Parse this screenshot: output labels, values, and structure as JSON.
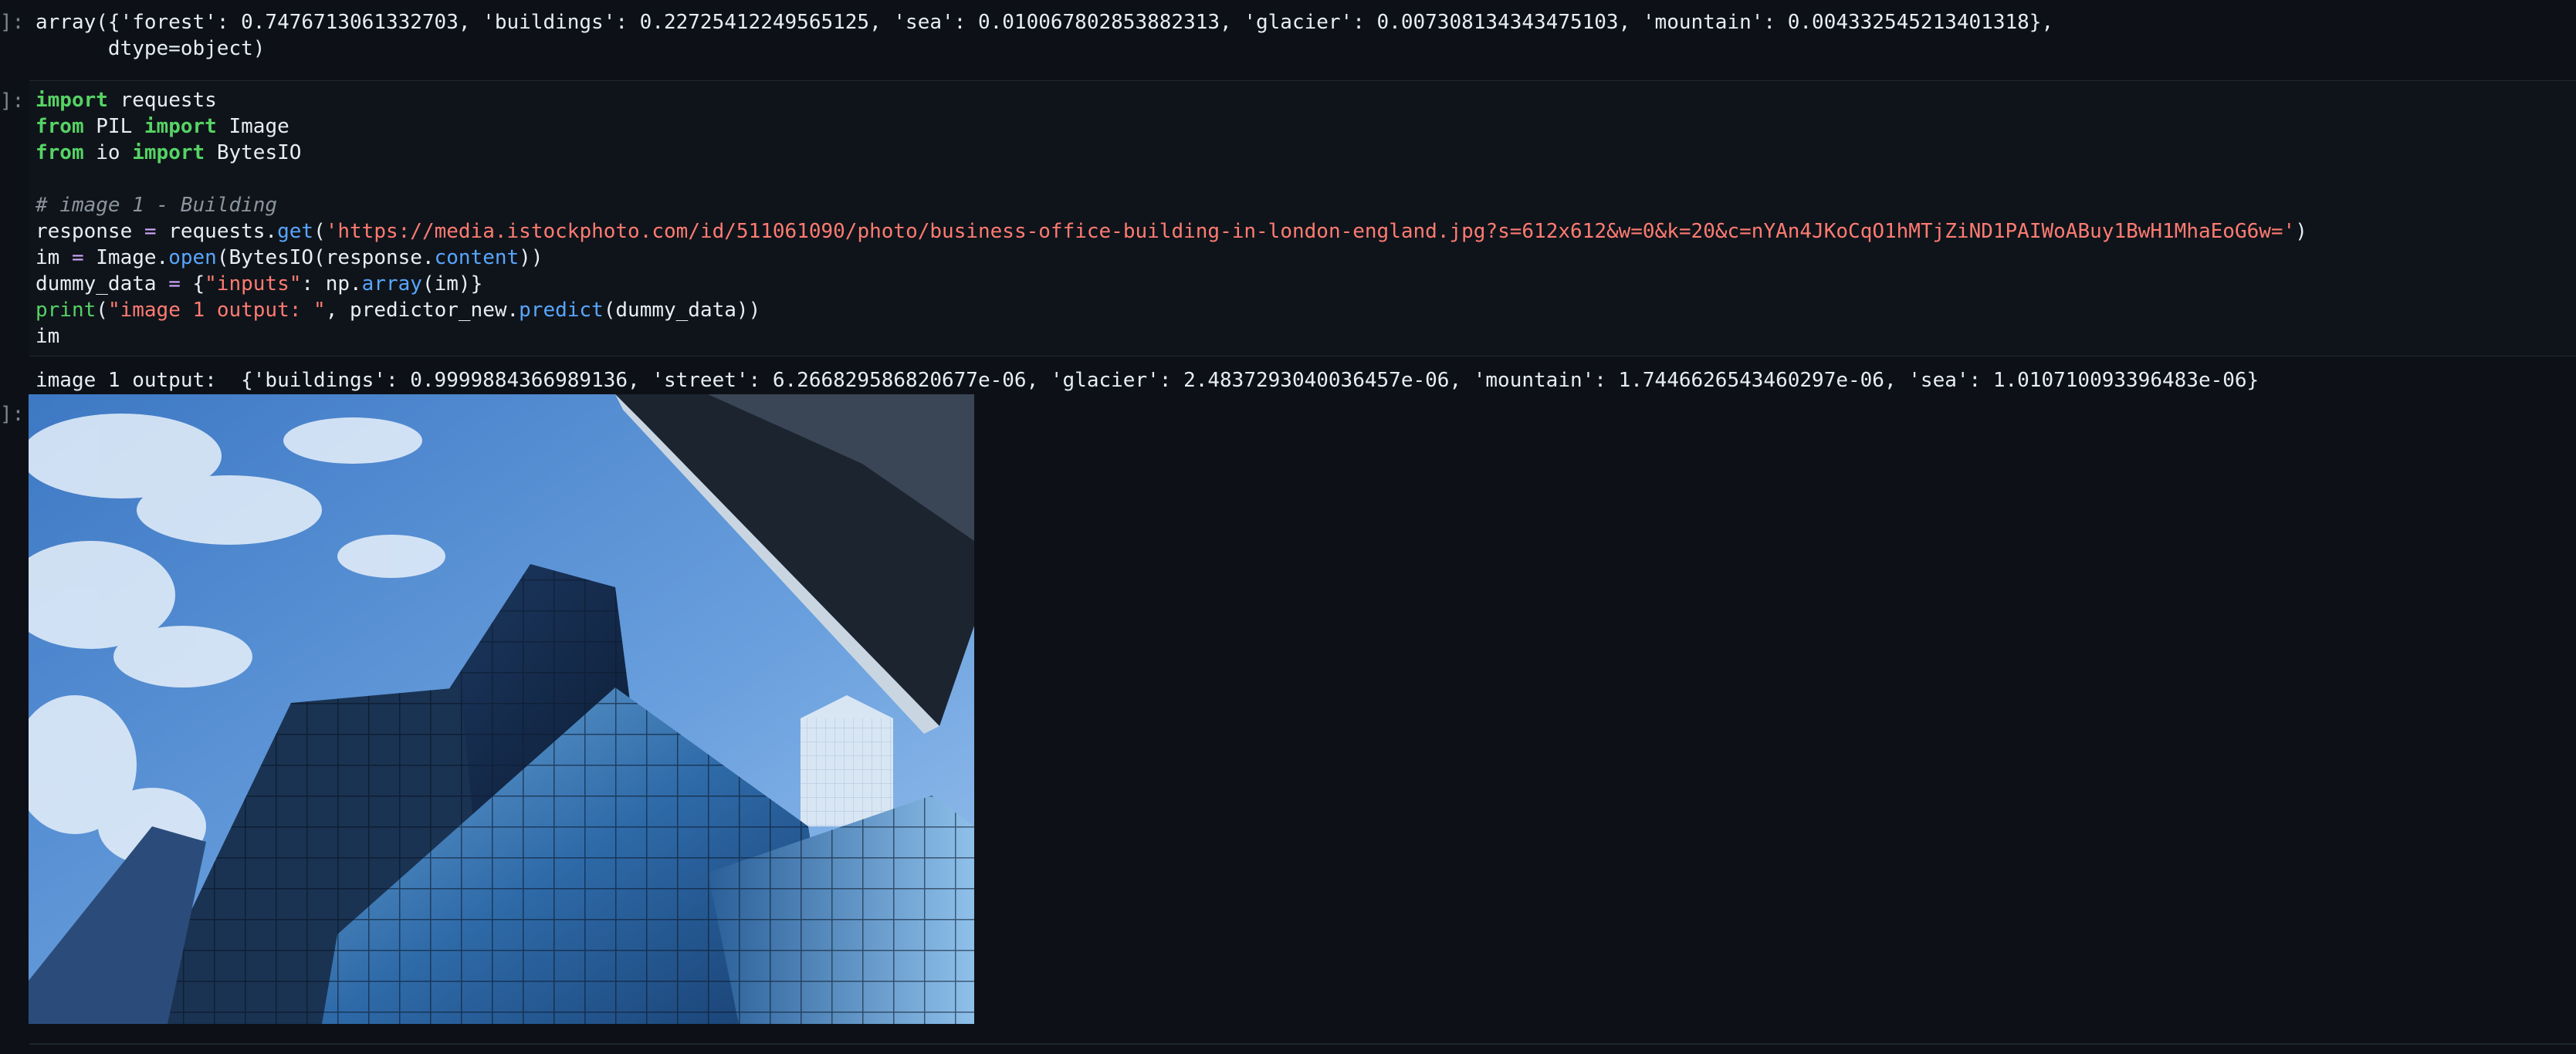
{
  "top_output": {
    "line1": "array({'forest': 0.7476713061332703, 'buildings': 0.22725412249565125, 'sea': 0.010067802853882313, 'glacier': 0.007308134343475103, 'mountain': 0.004332545213401318},",
    "line2": "      dtype=object)"
  },
  "prompts": {
    "p1": "]:",
    "p2": "]:",
    "p3": "]:"
  },
  "code": {
    "l1_kw": "import",
    "l1_rest": " requests",
    "l2_kw1": "from",
    "l2_mid": " PIL ",
    "l2_kw2": "import",
    "l2_rest": " Image",
    "l3_kw1": "from",
    "l3_mid": " io ",
    "l3_kw2": "import",
    "l3_rest": " BytesIO",
    "l5_comment": "# image 1 - Building",
    "l6_a": "response ",
    "l6_op": "=",
    "l6_b": " requests.",
    "l6_fn": "get",
    "l6_c": "(",
    "l6_str": "'https://media.istockphoto.com/id/511061090/photo/business-office-building-in-london-england.jpg?s=612x612&w=0&k=20&c=nYAn4JKoCqO1hMTjZiND1PAIWoABuy1BwH1MhaEoG6w='",
    "l6_d": ")",
    "l7_a": "im ",
    "l7_op": "=",
    "l7_b": " Image.",
    "l7_fn": "open",
    "l7_c": "(BytesIO(response.",
    "l7_fn2": "content",
    "l7_d": "))",
    "l8_a": "dummy_data ",
    "l8_op": "=",
    "l8_b": " {",
    "l8_str": "\"inputs\"",
    "l8_c": ": np.",
    "l8_fn": "array",
    "l8_d": "(im)}",
    "l9_bi": "print",
    "l9_a": "(",
    "l9_str": "\"image 1 output: \"",
    "l9_b": ", predictor_new.",
    "l9_fn": "predict",
    "l9_c": "(dummy_data))",
    "l10": "im"
  },
  "result_output": "image 1 output:  {'buildings': 0.9999884366989136, 'street': 6.266829586820677e-06, 'glacier': 2.4837293040036457e-06, 'mountain': 1.7446626543460297e-06, 'sea': 1.010710093396483e-06}",
  "image": {
    "subject": "business-office-building-photo"
  }
}
